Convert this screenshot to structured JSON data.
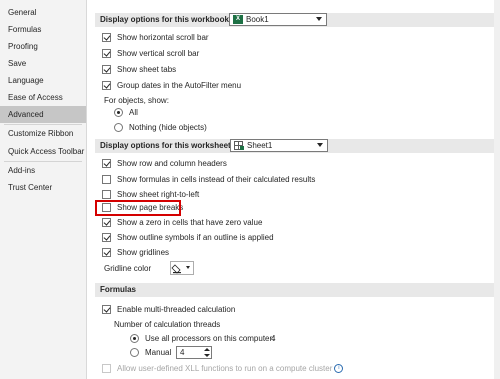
{
  "sidebar": {
    "items": [
      {
        "label": "General"
      },
      {
        "label": "Formulas"
      },
      {
        "label": "Proofing"
      },
      {
        "label": "Save"
      },
      {
        "label": "Language"
      },
      {
        "label": "Ease of Access"
      },
      {
        "label": "Advanced",
        "selected": true
      },
      {
        "label": "Customize Ribbon"
      },
      {
        "label": "Quick Access Toolbar"
      },
      {
        "label": "Add-ins"
      },
      {
        "label": "Trust Center"
      }
    ]
  },
  "workbook_section": {
    "title": "Display options for this workbook:",
    "dropdown_value": "Book1",
    "options": [
      {
        "label": "Show horizontal scroll bar",
        "checked": true
      },
      {
        "label": "Show vertical scroll bar",
        "checked": true
      },
      {
        "label": "Show sheet tabs",
        "checked": true
      },
      {
        "label": "Group dates in the AutoFilter menu",
        "checked": true
      }
    ],
    "objects_label": "For objects, show:",
    "radio_all": "All",
    "radio_nothing": "Nothing (hide objects)"
  },
  "worksheet_section": {
    "title": "Display options for this worksheet:",
    "dropdown_value": "Sheet1",
    "options": [
      {
        "label": "Show row and column headers",
        "checked": true
      },
      {
        "label": "Show formulas in cells instead of their calculated results",
        "checked": false
      },
      {
        "label": "Show sheet right-to-left",
        "checked": false
      },
      {
        "label": "Show page breaks",
        "checked": false
      },
      {
        "label": "Show a zero in cells that have zero value",
        "checked": true
      },
      {
        "label": "Show outline symbols if an outline is applied",
        "checked": true
      },
      {
        "label": "Show gridlines",
        "checked": true
      }
    ],
    "gridline_color_label": "Gridline color"
  },
  "formulas_section": {
    "title": "Formulas",
    "multithread_label": "Enable multi-threaded calculation",
    "threads_label": "Number of calculation threads",
    "use_all_label": "Use all processors on this computer:",
    "use_all_value": "4",
    "manual_label": "Manual",
    "manual_value": "4",
    "xll_label": "Allow user-defined XLL functions to run on a compute cluster"
  },
  "colors": {
    "highlight": "#d40000",
    "selected_nav": "#c6c6c6",
    "section_bg": "#e8e8e8",
    "excel_green": "#1e7145"
  }
}
